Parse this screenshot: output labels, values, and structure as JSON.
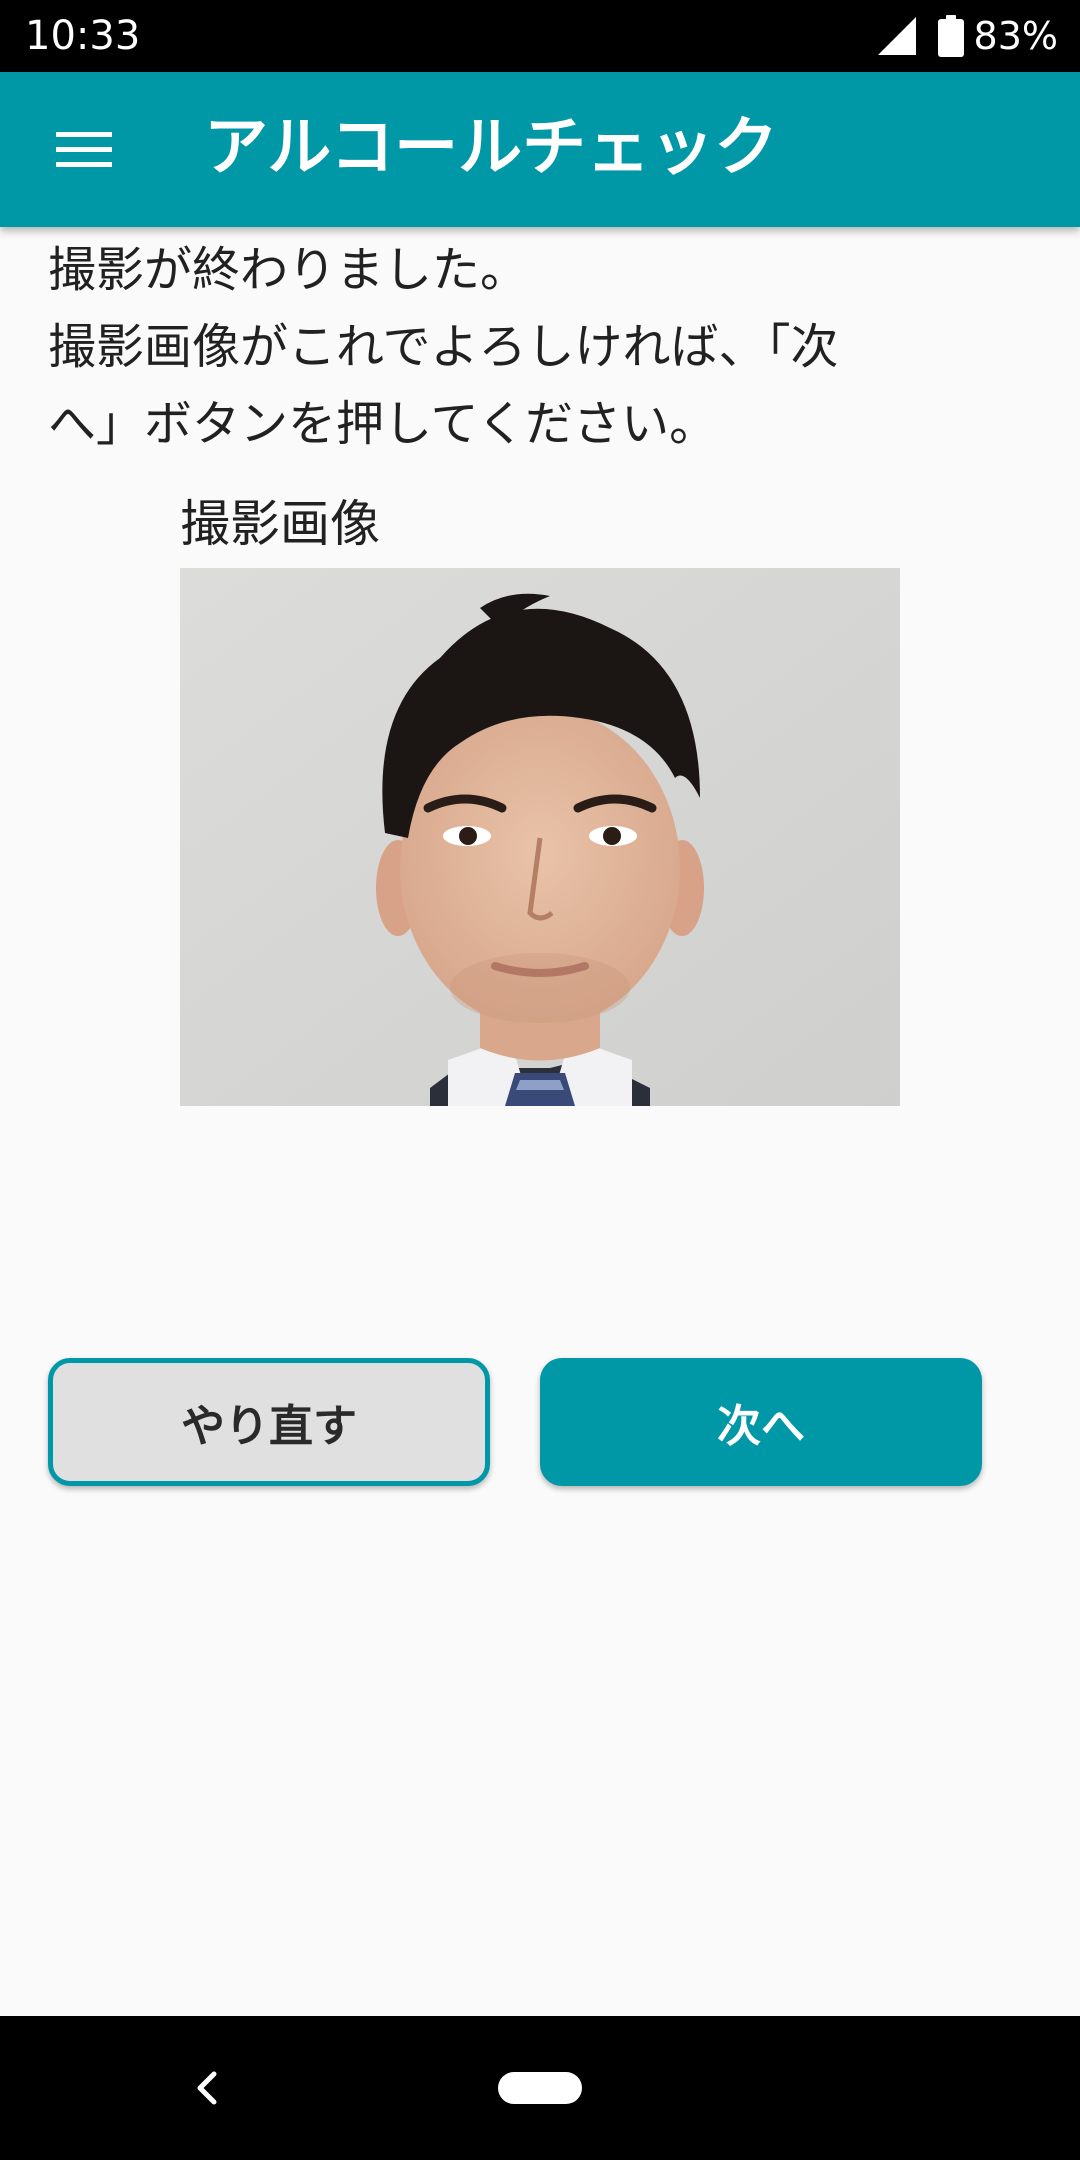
{
  "status_bar": {
    "time": "10:33",
    "battery": "83%",
    "icons": [
      "signal-icon",
      "battery-icon"
    ]
  },
  "app_bar": {
    "title": "アルコールチェック",
    "menu_icon": "hamburger-menu-icon",
    "background_color": "#0097a7"
  },
  "content": {
    "instruction_lines": [
      "撮影が終わりました。",
      "撮影画像がこれでよろしければ、「次",
      "へ」ボタンを押してください。"
    ],
    "image_label": "撮影画像"
  },
  "buttons": {
    "retry_label": "やり直す",
    "next_label": "次へ"
  },
  "nav_bar": {
    "icons": [
      "back-icon",
      "home-pill-icon"
    ]
  },
  "colors": {
    "accent": "#0097a7",
    "background": "#fafafa",
    "retry_button_bg": "#e0e0e0",
    "text": "#212121"
  }
}
